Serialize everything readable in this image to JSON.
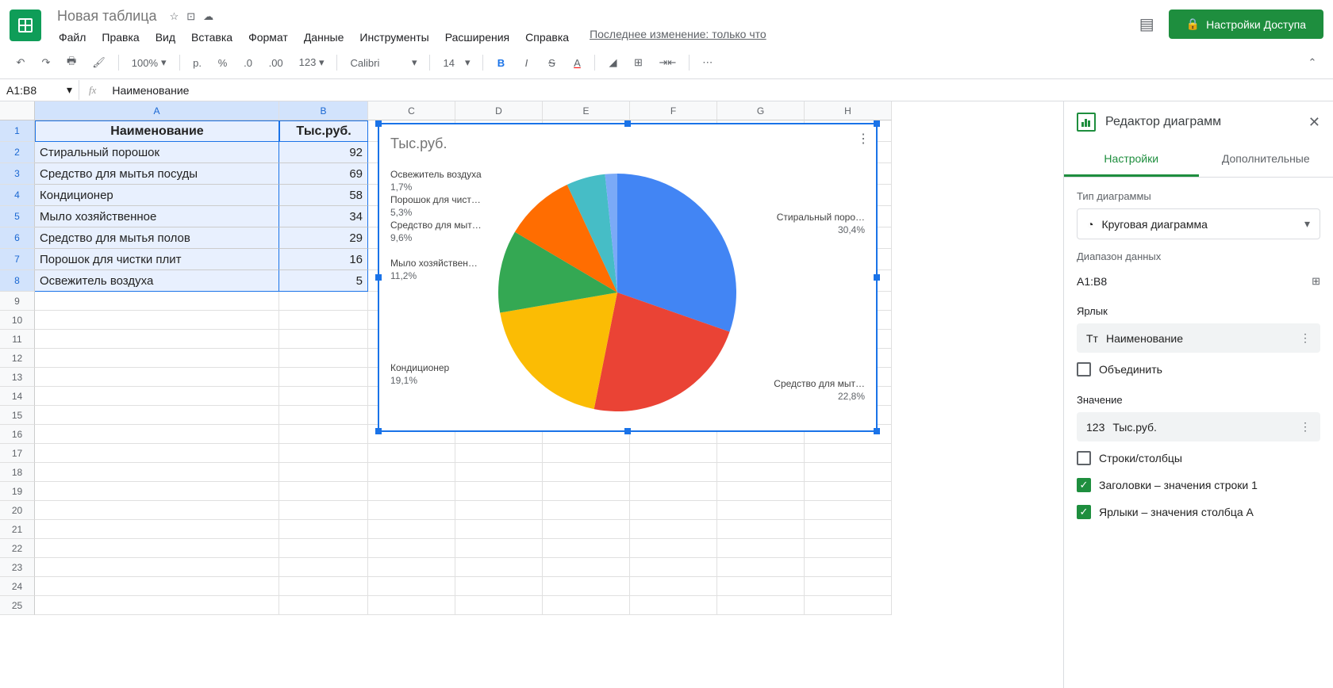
{
  "doc_title": "Новая таблица",
  "menu": [
    "Файл",
    "Правка",
    "Вид",
    "Вставка",
    "Формат",
    "Данные",
    "Инструменты",
    "Расширения",
    "Справка"
  ],
  "last_edit": "Последнее изменение: только что",
  "share_btn": "Настройки Доступа",
  "toolbar": {
    "zoom": "100%",
    "currency": "р.",
    "font": "Calibri",
    "font_size": "14"
  },
  "name_box": "A1:B8",
  "formula": "Наименование",
  "columns": [
    "A",
    "B",
    "C",
    "D",
    "E",
    "F",
    "G",
    "H"
  ],
  "headers": {
    "col1": "Наименование",
    "col2": "Тыс.руб."
  },
  "rows": [
    {
      "name": "Стиральный порошок",
      "val": "92"
    },
    {
      "name": "Средство для мытья посуды",
      "val": "69"
    },
    {
      "name": "Кондиционер",
      "val": "58"
    },
    {
      "name": "Мыло хозяйственное",
      "val": "34"
    },
    {
      "name": "Средство для мытья полов",
      "val": "29"
    },
    {
      "name": "Порошок для чистки плит",
      "val": "16"
    },
    {
      "name": "Освежитель воздуха",
      "val": "5"
    }
  ],
  "chart": {
    "title": "Тыс.руб.",
    "labels": [
      {
        "name": "Освежитель воздуха",
        "pct": "1,7%"
      },
      {
        "name": "Порошок для чист…",
        "pct": "5,3%"
      },
      {
        "name": "Средство для мыт…",
        "pct": "9,6%"
      },
      {
        "name": "Мыло хозяйствен…",
        "pct": "11,2%"
      },
      {
        "name": "Кондиционер",
        "pct": "19,1%"
      },
      {
        "name": "Стиральный поро…",
        "pct": "30,4%"
      },
      {
        "name": "Средство для мыт…",
        "pct": "22,8%"
      }
    ]
  },
  "sidebar": {
    "title": "Редактор диаграмм",
    "tab1": "Настройки",
    "tab2": "Дополнительные",
    "chart_type_label": "Тип диаграммы",
    "chart_type": "Круговая диаграмма",
    "range_label": "Диапазон данных",
    "range": "A1:B8",
    "label_section": "Ярлык",
    "label_chip": "Наименование",
    "combine": "Объединить",
    "value_section": "Значение",
    "value_chip": "Тыс.руб.",
    "switch": "Строки/столбцы",
    "headers_check": "Заголовки – значения строки 1",
    "labels_check": "Ярлыки – значения столбца A"
  },
  "chart_data": {
    "type": "pie",
    "title": "Тыс.руб.",
    "categories": [
      "Стиральный порошок",
      "Средство для мытья посуды",
      "Кондиционер",
      "Мыло хозяйственное",
      "Средство для мытья полов",
      "Порошок для чистки плит",
      "Освежитель воздуха"
    ],
    "values": [
      92,
      69,
      58,
      34,
      29,
      16,
      5
    ],
    "percentages": [
      30.4,
      22.8,
      19.1,
      11.2,
      9.6,
      5.3,
      1.7
    ],
    "colors": [
      "#4285f4",
      "#ea4335",
      "#fbbc04",
      "#34a853",
      "#ff6d01",
      "#46bdc6",
      "#7baaf7"
    ]
  }
}
